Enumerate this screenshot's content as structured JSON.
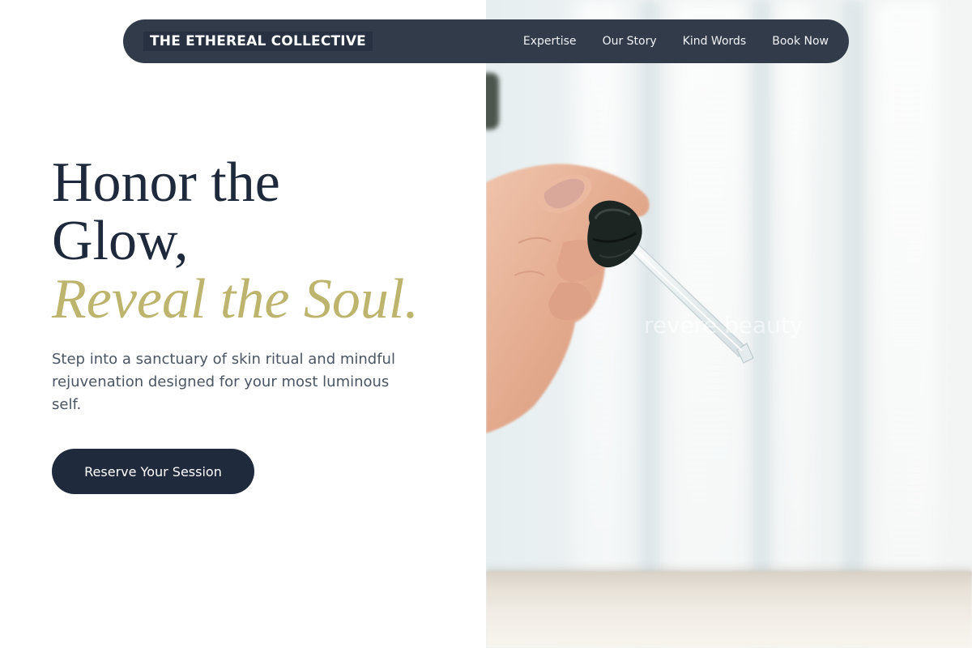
{
  "nav": {
    "brand": "THE ETHEREAL COLLECTIVE",
    "links": [
      {
        "label": "Expertise"
      },
      {
        "label": "Our Story"
      },
      {
        "label": "Kind Words"
      },
      {
        "label": "Book Now"
      }
    ]
  },
  "hero": {
    "heading_line1": "Honor the",
    "heading_line2": "Glow,",
    "heading_accent": "Reveal the Soul.",
    "subtitle": "Step into a sanctuary of skin ritual and mindful rejuvenation designed for your most luminous self.",
    "cta_label": "Reserve Your Session"
  },
  "photo": {
    "alt_caption": "revere beauty"
  },
  "colors": {
    "navy": "#1e293b",
    "nav_bg": "#313b4a",
    "accent_gold": "#bdb46e",
    "button_bg": "#1f2a3c",
    "body_text": "#4b5563"
  }
}
